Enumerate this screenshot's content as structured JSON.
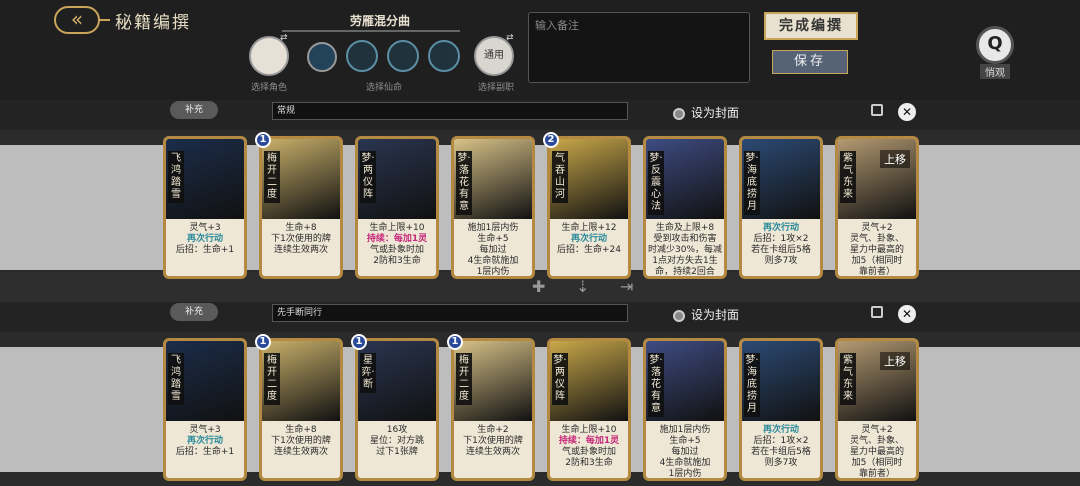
{
  "header": {
    "back_icon": "arrow-back-icon",
    "title": "秘籍编撰",
    "deck_name": "劳雁混分曲",
    "note_placeholder": "输入备注",
    "finish_label": "完成编撰",
    "save_label": "保存",
    "q_label": "悄观",
    "q_icon": "q-crest-icon",
    "accent": "#c9a55a"
  },
  "slots": {
    "role_label": "选择角色",
    "fate_label": "选择仙命",
    "deputy_label": "选择副职",
    "deputy_text": "通用"
  },
  "rows": [
    {
      "pill": "补充",
      "input": "常规",
      "cover": "设为封面",
      "cards": [
        {
          "name": "飞鸿踏雪",
          "badge": "",
          "lines": [
            [
              "灵气+3"
            ],
            [
              "再次行动"
            ],
            [
              "后招：生命+1"
            ]
          ]
        },
        {
          "name": "梅开二度",
          "badge": "1",
          "lines": [
            [
              "生命+8"
            ],
            [
              "下1次使用的牌"
            ],
            [
              "连续生效两次"
            ]
          ]
        },
        {
          "name": "梦·两仪阵",
          "badge": "",
          "lines": [
            [
              "生命上限+10"
            ],
            [
              "持续：每加1灵"
            ],
            [
              "气或卦象时加"
            ],
            [
              "2防和3生命"
            ]
          ]
        },
        {
          "name": "梦·落花有意",
          "badge": "",
          "lines": [
            [
              "施加1层内伤"
            ],
            [
              "生命+5"
            ],
            [
              "每加过"
            ],
            [
              "4生命就施加"
            ],
            [
              "1层内伤"
            ]
          ]
        },
        {
          "name": "气吞山河",
          "badge": "2",
          "lines": [
            [
              "生命上限+12"
            ],
            [
              "再次行动"
            ],
            [
              "后招：生命+24"
            ]
          ]
        },
        {
          "name": "梦·反震心法",
          "badge": "",
          "lines": [
            [
              "生命及上限+8"
            ],
            [
              "受到攻击和伤害"
            ],
            [
              "时减少30%，每减"
            ],
            [
              "1点对方失去1生"
            ],
            [
              "命，持续2回合"
            ]
          ]
        },
        {
          "name": "梦·海底捞月",
          "badge": "",
          "lines": [
            [
              "再次行动"
            ],
            [
              "后招：1攻×2"
            ],
            [
              "若在卡组后5格"
            ],
            [
              "则多7攻"
            ]
          ]
        },
        {
          "name": "紫气东来",
          "badge": "",
          "lines": [
            [
              "灵气+2"
            ],
            [
              "灵气、卦象、"
            ],
            [
              "星力中最高的"
            ],
            [
              "加5（相同时"
            ],
            [
              "靠前者）"
            ]
          ]
        }
      ]
    },
    {
      "pill": "补充",
      "input": "先手断同行",
      "cover": "设为封面",
      "cards": [
        {
          "name": "飞鸿踏雪",
          "badge": "",
          "lines": [
            [
              "灵气+3"
            ],
            [
              "再次行动"
            ],
            [
              "后招：生命+1"
            ]
          ]
        },
        {
          "name": "梅开二度",
          "badge": "1",
          "lines": [
            [
              "生命+8"
            ],
            [
              "下1次使用的牌"
            ],
            [
              "连续生效两次"
            ]
          ]
        },
        {
          "name": "星弈·断",
          "badge": "1",
          "lines": [
            [
              "16攻"
            ],
            [
              "星位：对方跳"
            ],
            [
              "过下1张牌"
            ]
          ]
        },
        {
          "name": "梅开二度",
          "badge": "1",
          "lines": [
            [
              "生命+2"
            ],
            [
              "下1次使用的牌"
            ],
            [
              "连续生效两次"
            ]
          ]
        },
        {
          "name": "梦·两仪阵",
          "badge": "",
          "lines": [
            [
              "生命上限+10"
            ],
            [
              "持续：每加1灵"
            ],
            [
              "气或卦象时加"
            ],
            [
              "2防和3生命"
            ]
          ]
        },
        {
          "name": "梦·落花有意",
          "badge": "",
          "lines": [
            [
              "施加1层内伤"
            ],
            [
              "生命+5"
            ],
            [
              "每加过"
            ],
            [
              "4生命就施加"
            ],
            [
              "1层内伤"
            ]
          ]
        },
        {
          "name": "梦·海底捞月",
          "badge": "",
          "lines": [
            [
              "再次行动"
            ],
            [
              "后招：1攻×2"
            ],
            [
              "若在卡组后5格"
            ],
            [
              "则多7攻"
            ]
          ]
        },
        {
          "name": "紫气东来",
          "badge": "",
          "lines": [
            [
              "灵气+2"
            ],
            [
              "灵气、卦象、"
            ],
            [
              "星力中最高的"
            ],
            [
              "加5（相同时"
            ],
            [
              "靠前者）"
            ]
          ]
        }
      ]
    }
  ],
  "move_up_label": "上移",
  "icons": [
    "add-icon",
    "split-icon",
    "exit-icon",
    "copy-icon",
    "close-icon"
  ]
}
